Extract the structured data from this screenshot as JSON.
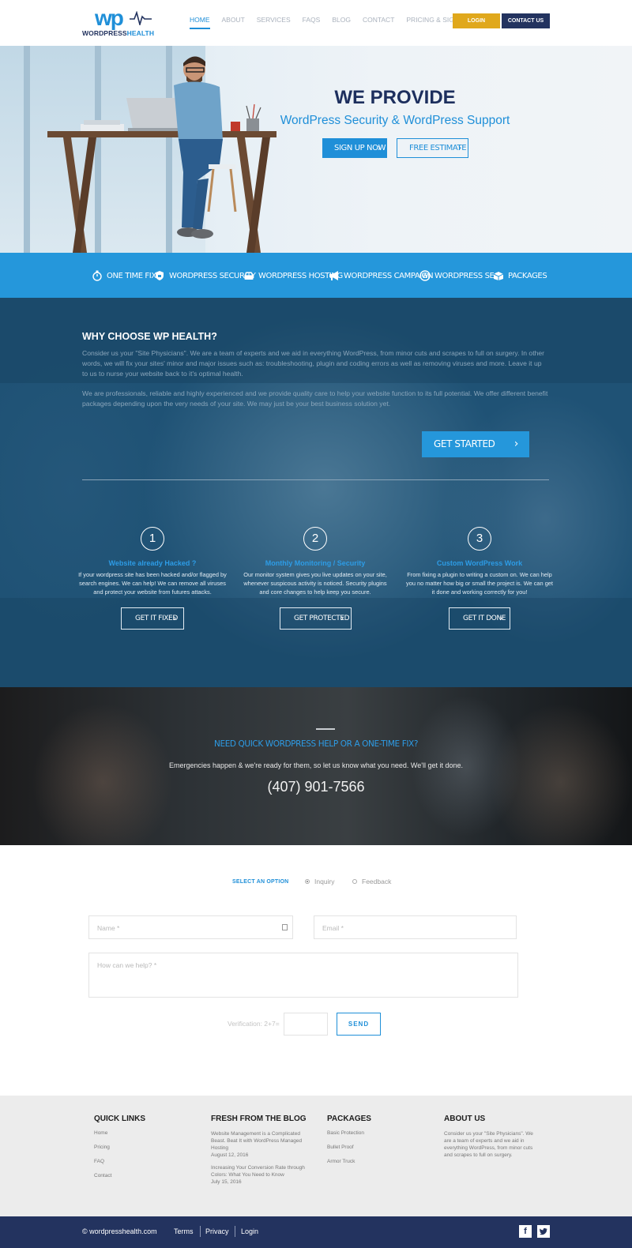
{
  "header": {
    "logo_mark": "wp",
    "logo_text_a": "WORDPRESS",
    "logo_text_b": "HEALTH",
    "nav": [
      "HOME",
      "ABOUT",
      "SERVICES",
      "FAQS",
      "BLOG",
      "CONTACT",
      "PRICING & SIGNUP"
    ],
    "login": "LOGIN",
    "contact": "CONTACT US"
  },
  "hero": {
    "title": "WE PROVIDE",
    "subtitle": "WordPress Security & WordPress Support",
    "signup": "SIGN UP NOW",
    "estimate": "FREE ESTIMATE"
  },
  "services": [
    "ONE TIME FIX",
    "WORDPRESS SECURITY",
    "WORDPRESS HOSTING",
    "WORDPRESS CAMPAIGN",
    "WORDPRESS SEO",
    "PACKAGES"
  ],
  "why": {
    "title": "WHY CHOOSE WP HEALTH?",
    "p1": "Consider us your \"Site Physicians\". We are a team of experts and we aid in everything WordPress, from minor cuts and scrapes to full on surgery. In other words, we will fix your sites' minor and major issues such as: troubleshooting, plugin and coding errors as well as removing viruses and more. Leave it up to us to nurse your website back to it's optimal health.",
    "p2": "We are professionals, reliable and highly experienced and we provide quality care to help your website function to its full potential. We offer different benefit packages depending upon the very needs of your site. We may just be your best business solution yet.",
    "cta": "GET STARTED",
    "steps": [
      {
        "num": "1",
        "title": "Website already Hacked ?",
        "text": "If your wordpress site has been hacked and/or flagged by search engines. We can help! We can remove all viruses and protect your website from futures attacks.",
        "button": "GET IT FIXED"
      },
      {
        "num": "2",
        "title": "Monthly Monitoring / Security",
        "text": "Our monitor system gives you live updates on your site, whenever suspicous activity is noticed. Security plugins and core changes to help keep you secure.",
        "button": "GET PROTECTED"
      },
      {
        "num": "3",
        "title": "Custom WordPress Work",
        "text": "From fixing a plugin to writing a custom on. We can help you no matter how big or small the project is. We can get it done and working correctly for you!",
        "button": "GET IT DONE"
      }
    ]
  },
  "help": {
    "title": "NEED QUICK WORDPRESS HELP OR A ONE-TIME FIX?",
    "subtitle": "Emergencies happen & we're ready for them, so let us know what you need. We'll get it done.",
    "phone": "(407) 901-7566"
  },
  "form": {
    "select_label": "SELECT AN OPTION",
    "options": [
      "Inquiry",
      "Feedback"
    ],
    "selected": "Inquiry",
    "name_placeholder": "Name *",
    "email_placeholder": "Email *",
    "message_placeholder": "How can we help? *",
    "verification": "Verification: 2+7=",
    "send": "SEND"
  },
  "footer": {
    "quick_links_title": "QUICK LINKS",
    "quick_links": [
      "Home",
      "Pricing",
      "FAQ",
      "Contact"
    ],
    "blog_title": "FRESH FROM THE BLOG",
    "blog": [
      {
        "title": "Website Management is a Complicated Beast. Beat It with WordPress Managed Hosting",
        "date": "August 12, 2016"
      },
      {
        "title": "Increasing Your Conversion Rate through Colors: What You Need to Know",
        "date": "July 15, 2016"
      }
    ],
    "packages_title": "PACKAGES",
    "packages": [
      "Basic Protection",
      "Bullet Proof",
      "Armor Truck"
    ],
    "about_title": "ABOUT US",
    "about_text": "Consider us your \"Site Physicians\". We are a team of experts and we aid in everything WordPress, from minor cuts and scrapes to full on surgery."
  },
  "bottom": {
    "copyright": "© wordpresshealth.com",
    "links": [
      "Terms",
      "Privacy",
      "Login"
    ],
    "social": [
      "facebook-icon",
      "twitter-icon"
    ]
  },
  "colors": {
    "accent": "#1f8fd8",
    "navy": "#23335f",
    "gold": "#e0a81c",
    "service_bar": "#2597db"
  }
}
